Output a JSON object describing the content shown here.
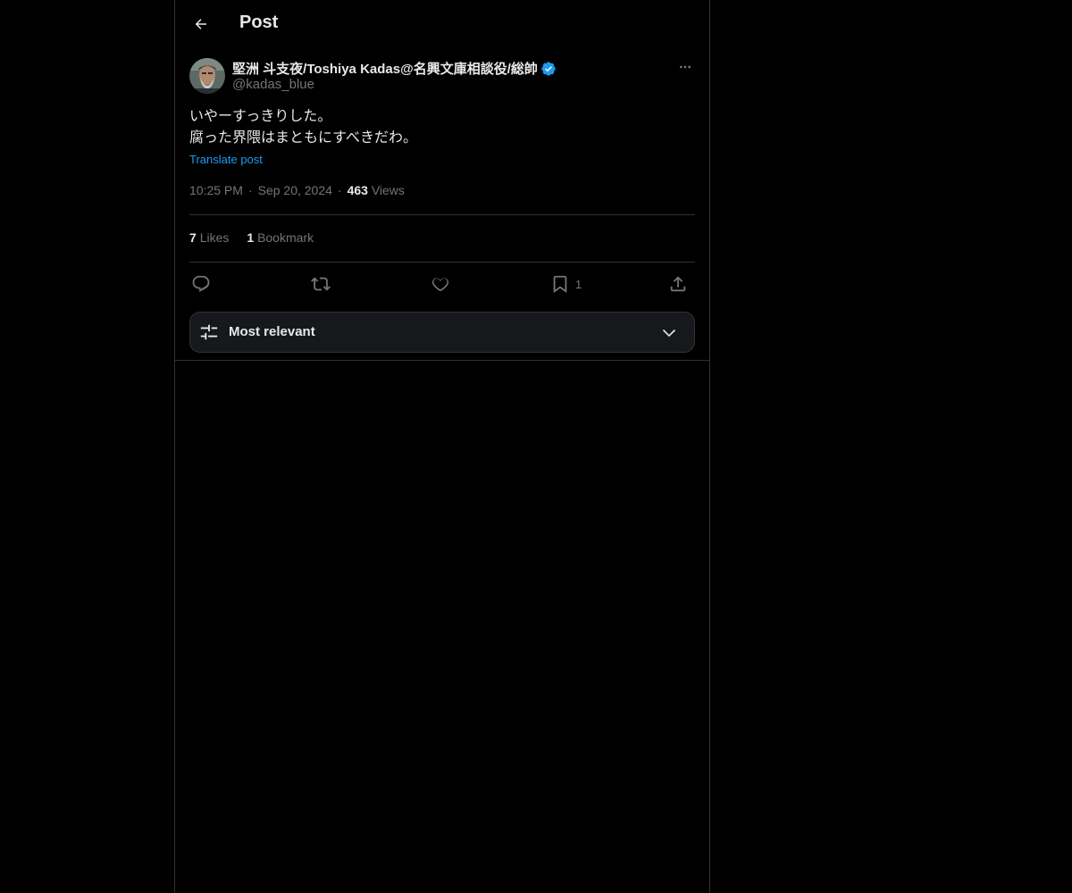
{
  "header": {
    "title": "Post"
  },
  "author": {
    "display_name": "堅洲 斗支夜/Toshiya Kadas@名興文庫相談役/総帥",
    "handle": "@kadas_blue",
    "verified": true
  },
  "post": {
    "lines": [
      "いやーすっきりした。",
      "腐った界隈はまともにすべきだわ。"
    ],
    "translate_label": "Translate post",
    "time": "10:25 PM",
    "date": "Sep 20, 2024",
    "views_count": "463",
    "views_label": "Views"
  },
  "stats": {
    "likes_count": "7",
    "likes_label": "Likes",
    "bookmarks_count": "1",
    "bookmarks_label": "Bookmark"
  },
  "actions": {
    "bookmark_count": "1"
  },
  "reply_filter": {
    "label": "Most relevant"
  },
  "colors": {
    "accent": "#1d9bf0",
    "muted": "#71767b",
    "text": "#e7e9ea",
    "border": "#2f3336",
    "background": "#000000"
  },
  "icons": [
    "arrow-left-icon",
    "verified-badge-icon",
    "more-icon",
    "reply-icon",
    "repost-icon",
    "like-icon",
    "bookmark-icon",
    "share-icon",
    "sliders-icon",
    "chevron-down-icon"
  ]
}
